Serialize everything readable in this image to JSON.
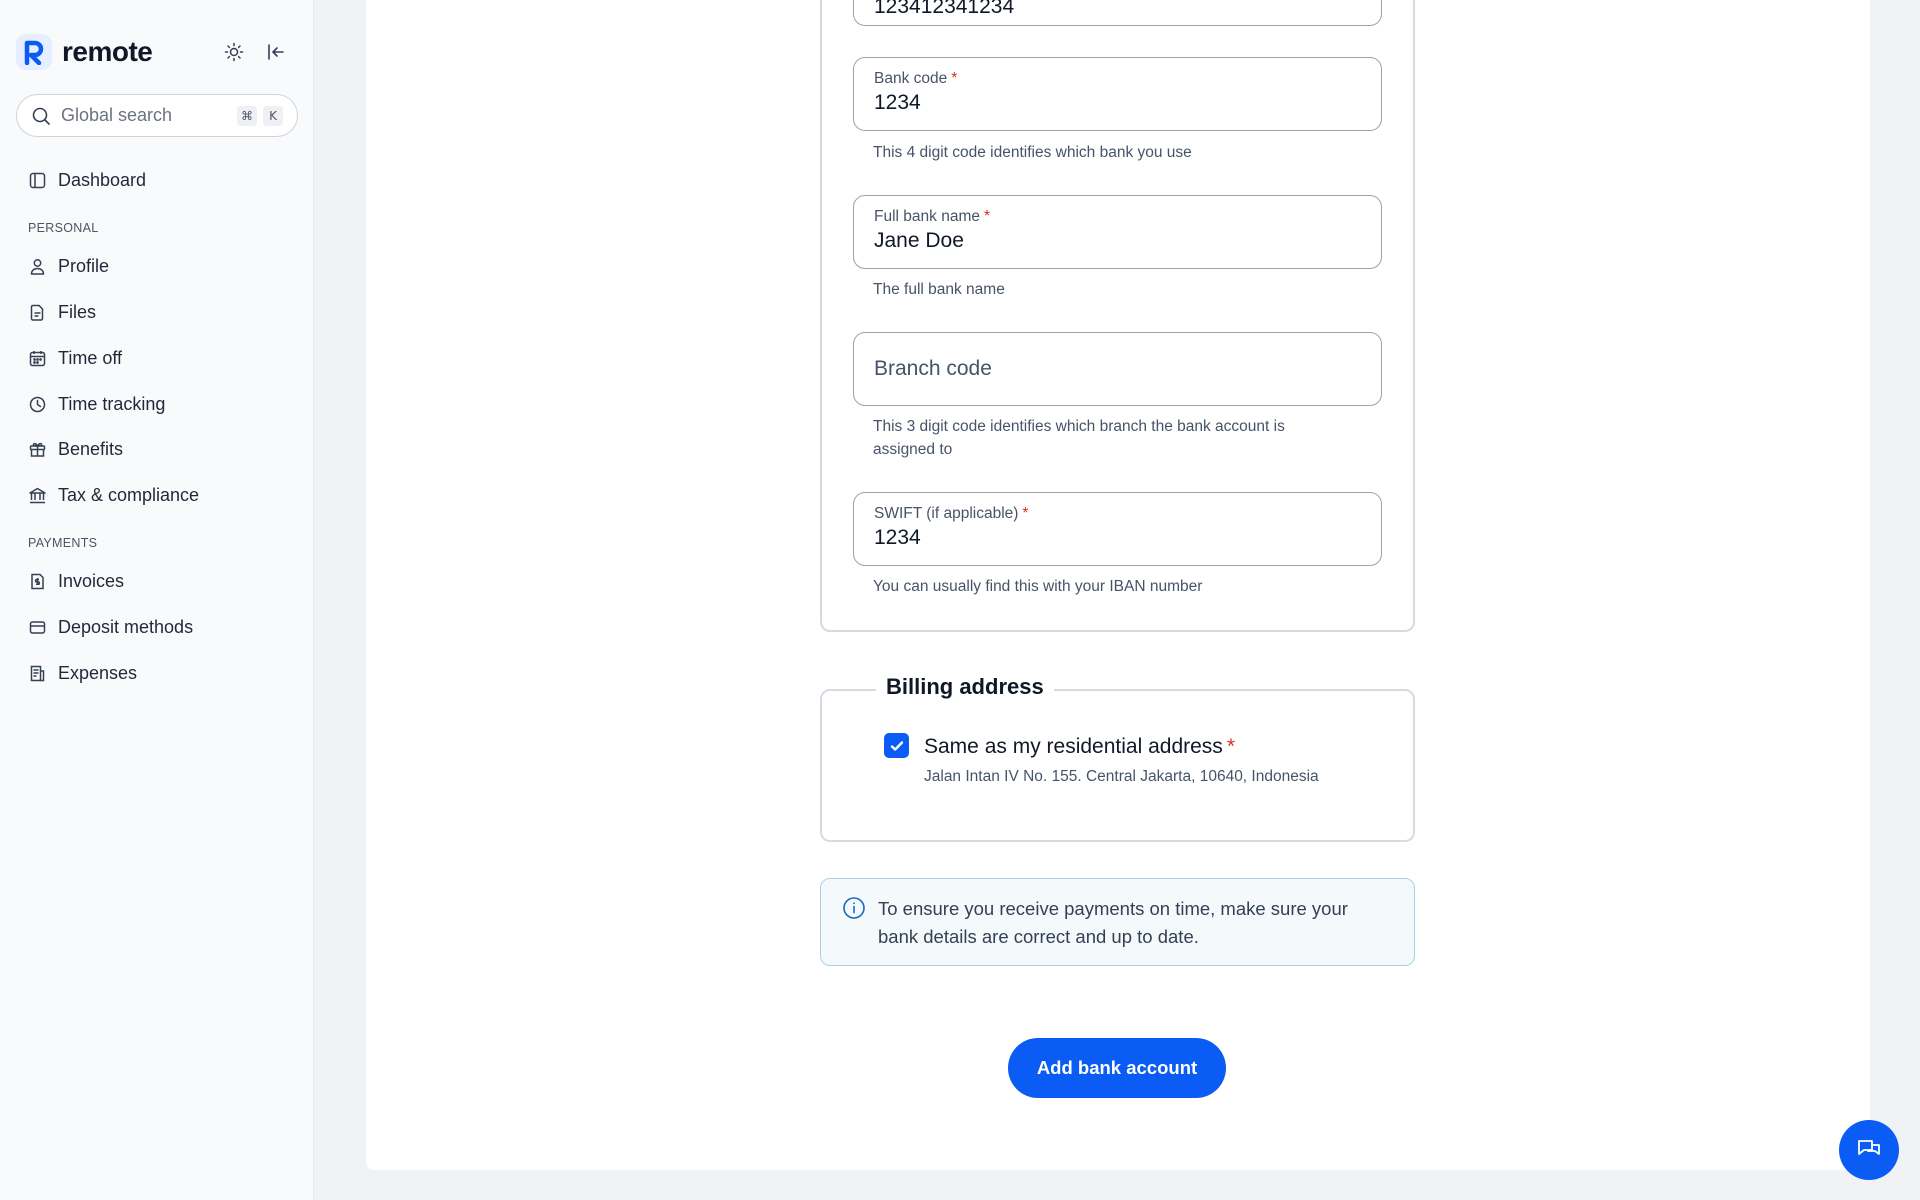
{
  "sidebar": {
    "brand": "remote",
    "search": {
      "placeholder": "Global search",
      "shortcut_cmd": "⌘",
      "shortcut_key": "K"
    },
    "dashboard": "Dashboard",
    "sections": {
      "personal": "PERSONAL",
      "payments": "PAYMENTS"
    },
    "personal_items": [
      {
        "label": "Profile",
        "icon": "person-icon"
      },
      {
        "label": "Files",
        "icon": "file-icon"
      },
      {
        "label": "Time off",
        "icon": "calendar-icon"
      },
      {
        "label": "Time tracking",
        "icon": "clock-icon"
      },
      {
        "label": "Benefits",
        "icon": "gift-icon"
      },
      {
        "label": "Tax & compliance",
        "icon": "bank-icon"
      }
    ],
    "payment_items": [
      {
        "label": "Invoices",
        "icon": "invoice-icon"
      },
      {
        "label": "Deposit methods",
        "icon": "card-icon"
      },
      {
        "label": "Expenses",
        "icon": "receipt-icon"
      }
    ]
  },
  "form": {
    "top_field_value": "123412341234",
    "bank_code": {
      "label": "Bank code",
      "value": "1234",
      "help": "This 4 digit code identifies which bank you use"
    },
    "full_bank_name": {
      "label": "Full bank name",
      "value": "Jane Doe",
      "help": "The full bank name"
    },
    "branch_code": {
      "placeholder": "Branch code",
      "help_line1": "This 3 digit code identifies which branch the bank account is",
      "help_line2": "assigned to"
    },
    "swift": {
      "label": "SWIFT (if applicable)",
      "value": "1234",
      "help": "You can usually find this with your IBAN number"
    },
    "required_mark": "*"
  },
  "billing": {
    "title": "Billing address",
    "same_as_residential": "Same as my residential address",
    "address": "Jalan Intan IV No. 155. Central Jakarta,  10640,  Indonesia"
  },
  "info": {
    "line1": "To ensure you receive payments on time, make sure your",
    "line2": "bank details are correct and up to date."
  },
  "actions": {
    "add_bank_account": "Add bank account"
  },
  "colors": {
    "primary": "#0a5cf5",
    "required": "#d92d20",
    "info_border": "#a8d1e8"
  }
}
